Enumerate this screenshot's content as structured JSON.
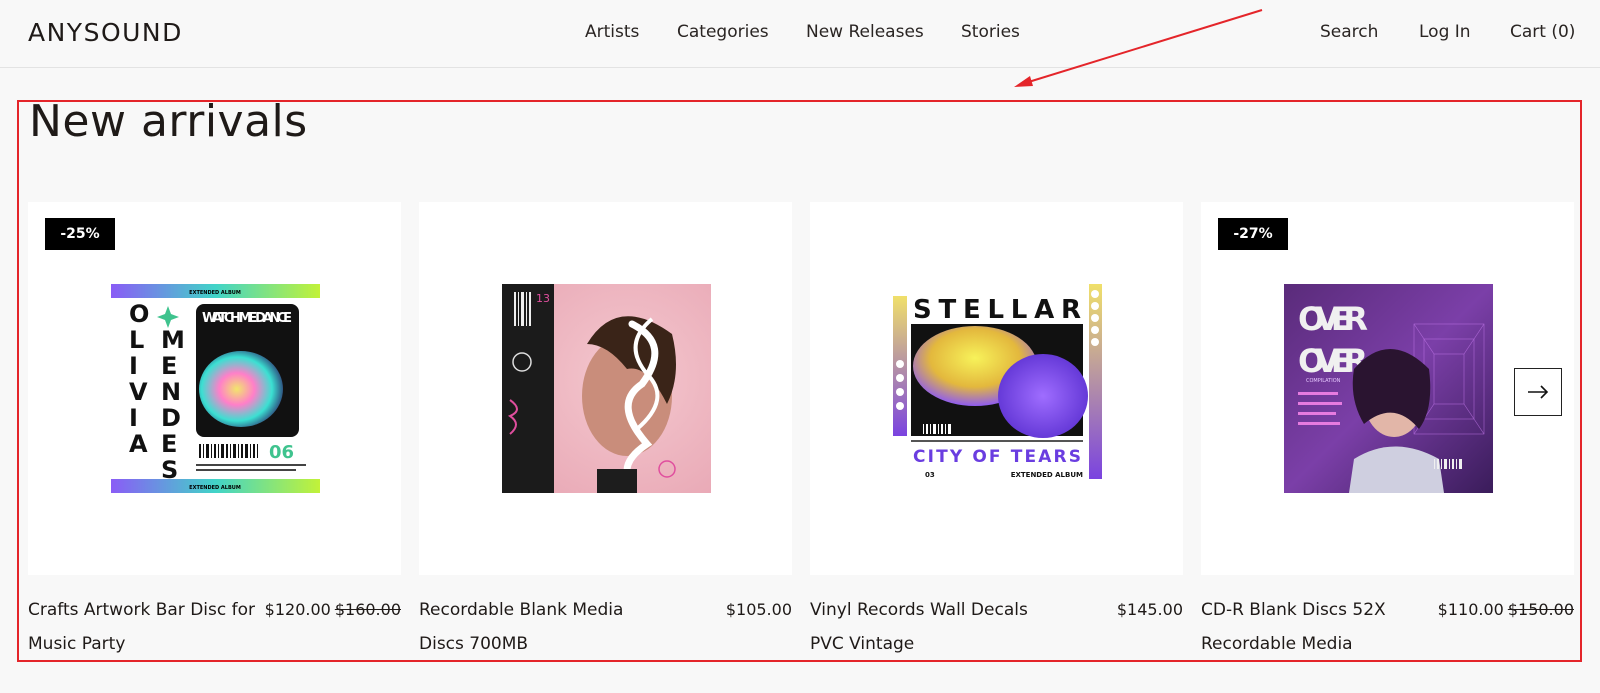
{
  "brand": {
    "logo": "ANYSOUND"
  },
  "nav": [
    {
      "label": "Artists"
    },
    {
      "label": "Categories"
    },
    {
      "label": "New Releases"
    },
    {
      "label": "Stories"
    }
  ],
  "utility": {
    "search": "Search",
    "login": "Log In",
    "cart": "Cart (0)"
  },
  "section": {
    "title": "New arrivals"
  },
  "products": [
    {
      "title": "Crafts Artwork Bar Disc for Music Party",
      "price": "$120.00",
      "old_price": "$160.00",
      "badge": "-25%",
      "cover": {
        "name_letters_left": [
          "O",
          "L",
          "I",
          "V",
          "I",
          "A"
        ],
        "name_letters_right": [
          "M",
          "E",
          "N",
          "D",
          "E",
          "S"
        ],
        "headline": "WATCH ME DANCE",
        "number": "06",
        "top_text": "EXTENDED ALBUM",
        "bottom_text": "EXTENDED ALBUM"
      }
    },
    {
      "title": "Recordable Blank Media Discs 700MB",
      "price": "$105.00",
      "old_price": "",
      "badge": "",
      "cover": {
        "number": "13"
      }
    },
    {
      "title": "Vinyl Records Wall Decals PVC Vintage",
      "price": "$145.00",
      "old_price": "",
      "badge": "",
      "cover": {
        "headline": "STELLAR",
        "subhead": "CITY OF TEARS",
        "caption": "EXTENDED ALBUM",
        "number": "03"
      }
    },
    {
      "title": "CD-R Blank Discs 52X Recordable Media",
      "price": "$110.00",
      "old_price": "$150.00",
      "badge": "-27%",
      "cover": {
        "headline_1": "OVER",
        "headline_2": "OVER",
        "caption": "COMPILATION"
      }
    }
  ],
  "carousel": {
    "next_icon": "arrow-right-icon"
  },
  "annotation": {
    "color": "#e4252a"
  }
}
